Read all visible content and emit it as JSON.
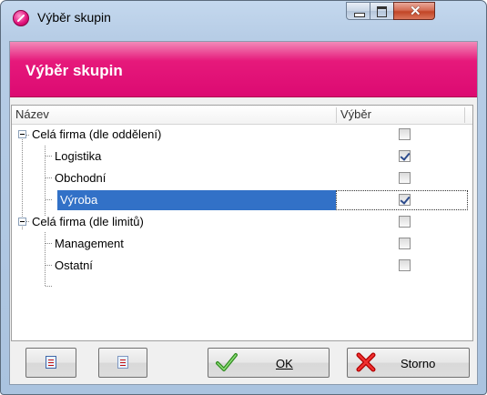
{
  "window": {
    "title": "Výběr skupin",
    "controls": {
      "minimize": "minimize",
      "maximize": "maximize",
      "close": "close"
    },
    "accent_color": "#dc0a72",
    "selection_color": "#3271c7"
  },
  "banner": {
    "title": "Výběr skupin"
  },
  "tree": {
    "columns": {
      "name": "Název",
      "selection": "Výběr"
    },
    "rows": [
      {
        "label": "Celá firma (dle oddělení)",
        "level": 0,
        "expander": "collapse",
        "checked": false,
        "selected": false
      },
      {
        "label": "Logistika",
        "level": 1,
        "checked": true,
        "selected": false
      },
      {
        "label": "Obchodní",
        "level": 1,
        "checked": false,
        "selected": false
      },
      {
        "label": "Výroba",
        "level": 1,
        "checked": true,
        "selected": true
      },
      {
        "label": "Celá firma (dle limitů)",
        "level": 0,
        "expander": "collapse",
        "checked": false,
        "selected": false
      },
      {
        "label": "Management",
        "level": 1,
        "checked": false,
        "selected": false
      },
      {
        "label": "Ostatní",
        "level": 1,
        "checked": false,
        "selected": false
      }
    ]
  },
  "buttons": {
    "check_all_icon": "check-list-icon",
    "uncheck_all_icon": "list-icon",
    "ok_label": "OK",
    "ok_icon": "check-mark-icon",
    "storno_label": "Storno",
    "storno_icon": "red-x-icon"
  }
}
